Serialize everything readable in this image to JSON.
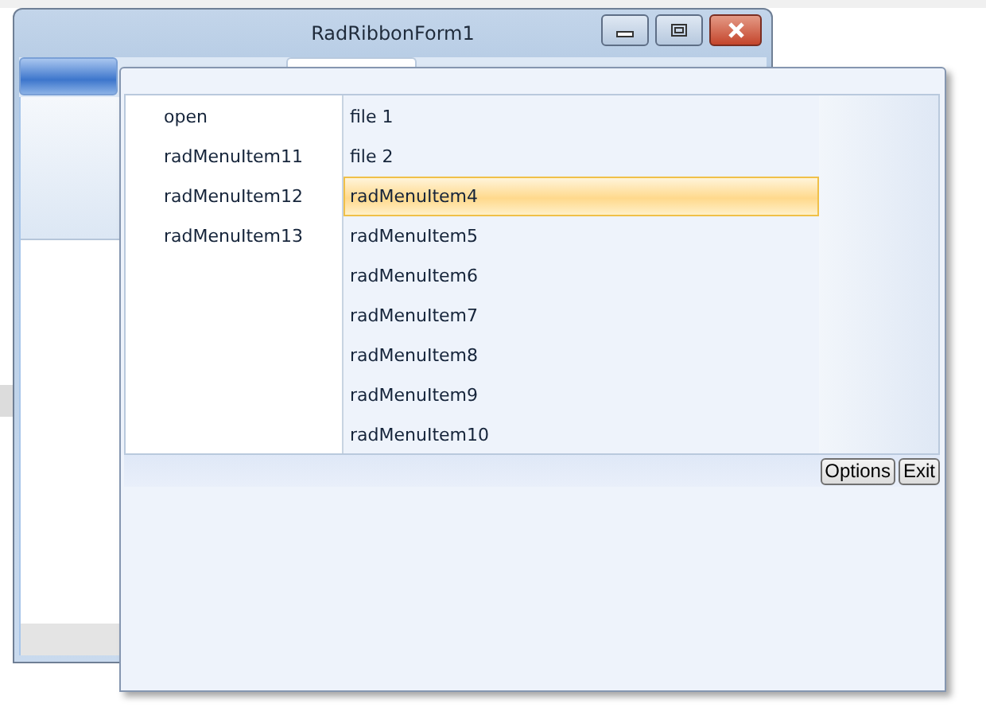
{
  "window": {
    "title": "RadRibbonForm1"
  },
  "menu": {
    "left_items": [
      {
        "label": "open"
      },
      {
        "label": "radMenuItem11"
      },
      {
        "label": "radMenuItem12"
      },
      {
        "label": "radMenuItem13"
      }
    ],
    "right_items": [
      {
        "label": "file 1",
        "selected": false
      },
      {
        "label": "file 2",
        "selected": false
      },
      {
        "label": "radMenuItem4",
        "selected": true
      },
      {
        "label": "radMenuItem5",
        "selected": false
      },
      {
        "label": "radMenuItem6",
        "selected": false
      },
      {
        "label": "radMenuItem7",
        "selected": false
      },
      {
        "label": "radMenuItem8",
        "selected": false
      },
      {
        "label": "radMenuItem9",
        "selected": false
      },
      {
        "label": "radMenuItem10",
        "selected": false
      }
    ],
    "buttons": [
      "Options",
      "Exit"
    ]
  }
}
